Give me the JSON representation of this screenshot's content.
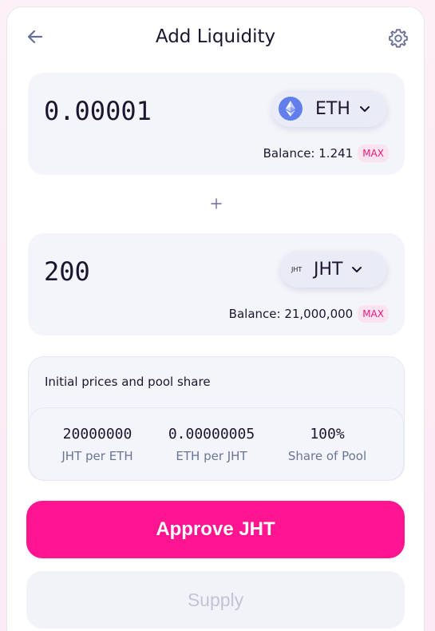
{
  "header": {
    "title": "Add Liquidity"
  },
  "input_a": {
    "value": "0.00001",
    "token_symbol": "ETH",
    "token_icon": "eth-logo-icon",
    "balance_text": "Balance: 1.241",
    "max_label": "MAX"
  },
  "input_b": {
    "value": "200",
    "token_symbol": "JHT",
    "token_logo_text": "JHT",
    "balance_text": "Balance: 21,000,000",
    "max_label": "MAX"
  },
  "prices": {
    "heading": "Initial prices and pool share",
    "items": [
      {
        "value": "20000000",
        "label": "JHT per ETH"
      },
      {
        "value": "0.00000005",
        "label": "ETH per JHT"
      },
      {
        "value": "100%",
        "label": "Share of Pool"
      }
    ]
  },
  "actions": {
    "approve_label": "Approve JHT",
    "supply_label": "Supply"
  },
  "colors": {
    "accent": "#ff158f",
    "max_text": "#e8197f",
    "panel_bg": "#f4f5fa",
    "disabled_text": "#c1c4d6"
  }
}
